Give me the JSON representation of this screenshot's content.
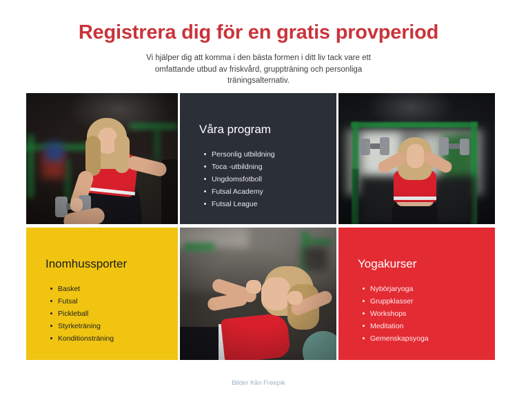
{
  "header": {
    "title": "Registrera dig för en gratis provperiod",
    "subtitle": "Vi hjälper dig att komma i den bästa formen i ditt liv tack vare ett omfattande utbud av friskvård, gruppträning och personliga träningsalternativ."
  },
  "colors": {
    "heading_red": "#C9343B",
    "panel_red": "#E32B34",
    "panel_yellow": "#F0C411",
    "panel_dark": "#2B2F38",
    "footer_link": "#9FB2C4",
    "page_background": "#FFFFFF"
  },
  "grid": {
    "cells": [
      {
        "type": "photo",
        "name": "photo-dumbbell-row",
        "alt": "Kvinna som tränar med hantel i ett gym"
      },
      {
        "type": "panel",
        "name": "programs",
        "theme": "dark",
        "title": "Våra program",
        "items": [
          "Personlig utbildning",
          "Toca -utbildning",
          "Ungdomsfotboll",
          "Futsal Academy",
          "Futsal League"
        ]
      },
      {
        "type": "photo",
        "name": "photo-shoulder-press",
        "alt": "Kvinna som lyfter hantlar över huvudet"
      },
      {
        "type": "panel",
        "name": "indoor-sports",
        "theme": "yellow",
        "title": "Inomhussporter",
        "items": [
          "Basket",
          "Futsal",
          "Pickleball",
          "Styrketräning",
          "Konditionsträning"
        ]
      },
      {
        "type": "photo",
        "name": "photo-situps",
        "alt": "Kvinna som gör situps på golvet"
      },
      {
        "type": "panel",
        "name": "yoga-courses",
        "theme": "red",
        "title": "Yogakurser",
        "items": [
          "Nybörjaryoga",
          "Gruppklasser",
          "Workshops",
          "Meditation",
          "Gemenskapsyoga"
        ]
      }
    ]
  },
  "footer": {
    "credit": "Bilder från Freepik"
  }
}
